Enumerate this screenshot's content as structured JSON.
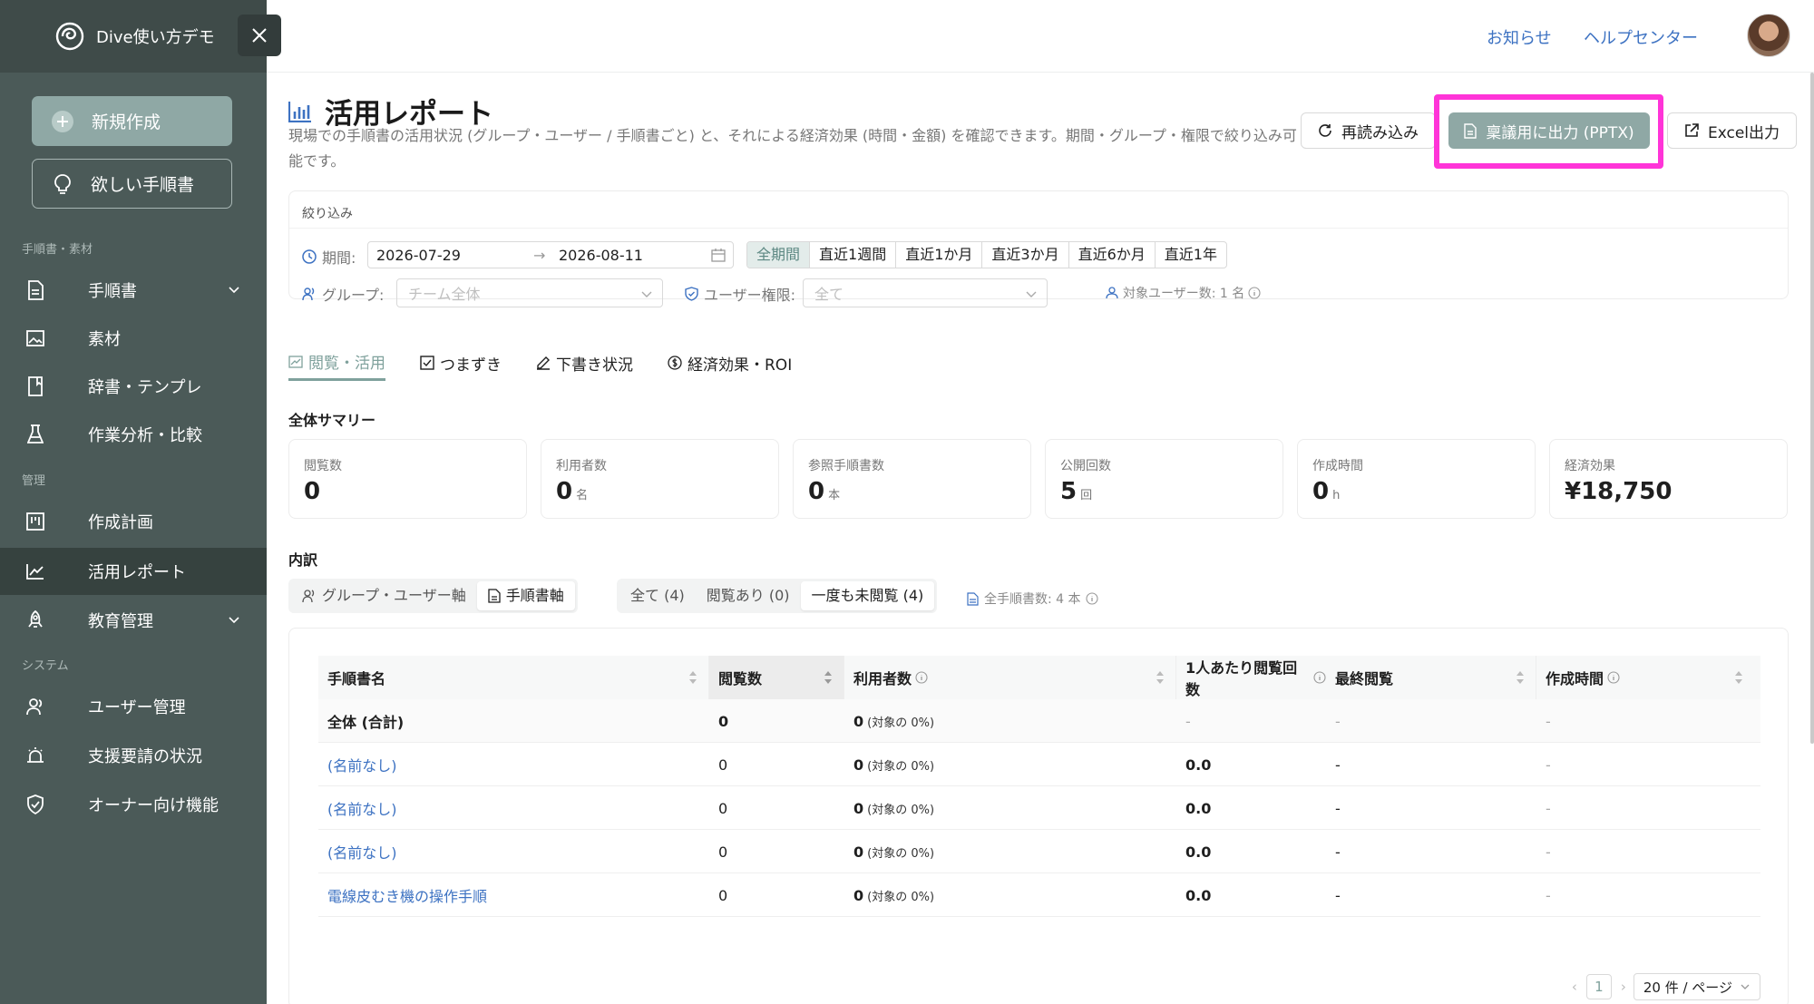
{
  "sidebar": {
    "workspace": "Dive使い方デモ",
    "new_button": "新規作成",
    "want_button": "欲しい手順書",
    "sections": [
      "手順書・素材",
      "管理",
      "システム"
    ],
    "items": [
      {
        "label": "手順書",
        "icon": "document-icon",
        "expandable": true
      },
      {
        "label": "素材",
        "icon": "image-icon"
      },
      {
        "label": "辞書・テンプレ",
        "icon": "book-icon"
      },
      {
        "label": "作業分析・比較",
        "icon": "flask-icon"
      },
      {
        "label": "作成計画",
        "icon": "board-icon"
      },
      {
        "label": "活用レポート",
        "icon": "chart-line-icon",
        "active": true
      },
      {
        "label": "教育管理",
        "icon": "rocket-icon",
        "expandable": true
      },
      {
        "label": "ユーザー管理",
        "icon": "users-icon"
      },
      {
        "label": "支援要請の状況",
        "icon": "alarm-icon"
      },
      {
        "label": "オーナー向け機能",
        "icon": "shield-icon"
      }
    ]
  },
  "header": {
    "notice_link": "お知らせ",
    "help_link": "ヘルプセンター"
  },
  "page": {
    "title": "活用レポート",
    "description": "現場での手順書の活用状況 (グループ・ユーザー / 手順書ごと) と、それによる経済効果 (時間・金額) を確認できます。期間・グループ・権限で絞り込み可能です。",
    "reload_button": "再読み込み",
    "pptx_button": "稟議用に出力 (PPTX)",
    "excel_button": "Excel出力"
  },
  "filter": {
    "title": "絞り込み",
    "period_label": "期間:",
    "date_from": "2026-07-29",
    "date_to": "2026-08-11",
    "ranges": [
      "全期間",
      "直近1週間",
      "直近1か月",
      "直近3か月",
      "直近6か月",
      "直近1年"
    ],
    "active_range": "全期間",
    "group_label": "グループ:",
    "group_placeholder": "チーム全体",
    "role_label": "ユーザー権限:",
    "role_placeholder": "全て",
    "target_users": "対象ユーザー数: 1 名"
  },
  "tabs": [
    {
      "label": "閲覧・活用",
      "icon": "chart-icon",
      "active": true
    },
    {
      "label": "つまずき",
      "icon": "checkbox-icon"
    },
    {
      "label": "下書き状況",
      "icon": "pencil-icon"
    },
    {
      "label": "経済効果・ROI",
      "icon": "dollar-circle-icon"
    }
  ],
  "summary": {
    "title": "全体サマリー",
    "cards": [
      {
        "label": "閲覧数",
        "value": "0",
        "unit": ""
      },
      {
        "label": "利用者数",
        "value": "0",
        "unit": "名"
      },
      {
        "label": "参照手順書数",
        "value": "0",
        "unit": "本"
      },
      {
        "label": "公開回数",
        "value": "5",
        "unit": "回"
      },
      {
        "label": "作成時間",
        "value": "0",
        "unit": "h"
      },
      {
        "label": "経済効果",
        "value": "¥18,750",
        "unit": ""
      }
    ]
  },
  "breakdown": {
    "title": "内訳",
    "axis_options": [
      "グループ・ユーザー軸",
      "手順書軸"
    ],
    "active_axis": "手順書軸",
    "view_filters": [
      "全て (4)",
      "閲覧あり (0)",
      "一度も未閲覧 (4)"
    ],
    "active_view_filter": "一度も未閲覧 (4)",
    "all_count": "全手順書数: 4 本"
  },
  "table": {
    "columns": [
      "手順書名",
      "閲覧数",
      "利用者数",
      "1人あたり閲覧回数",
      "最終閲覧",
      "作成時間"
    ],
    "rows": [
      {
        "name": "全体 (合計)",
        "views": "0",
        "users": "0",
        "users_note": "(対象の 0%)",
        "per_user": "-",
        "last": "-",
        "time": "-",
        "total": true
      },
      {
        "name": "(名前なし)",
        "views": "0",
        "users": "0",
        "users_note": "(対象の 0%)",
        "per_user": "0.0",
        "last": "-",
        "time": "-"
      },
      {
        "name": "(名前なし)",
        "views": "0",
        "users": "0",
        "users_note": "(対象の 0%)",
        "per_user": "0.0",
        "last": "-",
        "time": "-"
      },
      {
        "name": "(名前なし)",
        "views": "0",
        "users": "0",
        "users_note": "(対象の 0%)",
        "per_user": "0.0",
        "last": "-",
        "time": "-"
      },
      {
        "name": "電線皮むき機の操作手順",
        "views": "0",
        "users": "0",
        "users_note": "(対象の 0%)",
        "per_user": "0.0",
        "last": "-",
        "time": "-"
      }
    ],
    "pager": {
      "page": "1",
      "page_size": "20 件 / ページ"
    }
  }
}
